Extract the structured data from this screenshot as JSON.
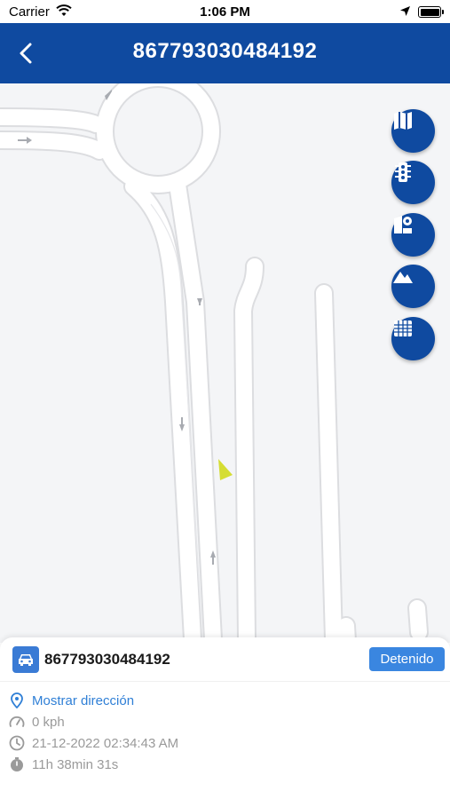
{
  "status_bar": {
    "carrier": "Carrier",
    "time": "1:06 PM"
  },
  "header": {
    "title": "867793030484192",
    "back_icon": "chevron-left-icon"
  },
  "map_controls": [
    {
      "name": "map-type-button",
      "icon": "map-icon"
    },
    {
      "name": "traffic-button",
      "icon": "traffic-light-icon"
    },
    {
      "name": "places-button",
      "icon": "geofence-icon"
    },
    {
      "name": "terrain-button",
      "icon": "mountain-icon"
    },
    {
      "name": "grid-button",
      "icon": "grid-icon"
    }
  ],
  "vehicle": {
    "name": "867793030484192",
    "status": "Detenido",
    "status_color": "#3a86e0",
    "show_address": "Mostrar dirección",
    "speed": "0 kph",
    "datetime": "21-12-2022 02:34:43 AM",
    "duration": "11h 38min 31s"
  },
  "colors": {
    "primary": "#0f4aa0",
    "map_background": "#f4f5f7",
    "marker": "#d5dd33"
  }
}
